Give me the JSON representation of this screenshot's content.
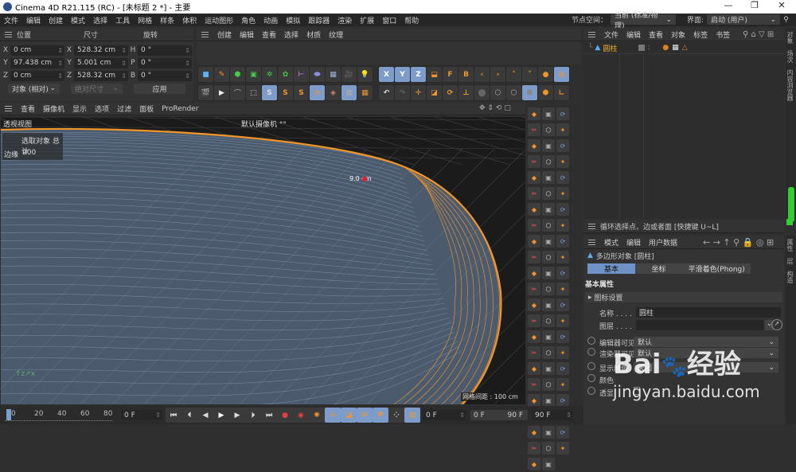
{
  "window": {
    "title": "Cinema 4D R21.115 (RC) - [未标题 2 *] - 主要",
    "min": "—",
    "max": "❐",
    "close": "✕"
  },
  "menu": [
    "文件",
    "编辑",
    "创建",
    "模式",
    "选择",
    "工具",
    "网格",
    "样条",
    "体积",
    "运动图形",
    "角色",
    "动画",
    "模拟",
    "跟踪器",
    "渲染",
    "扩展",
    "窗口",
    "帮助"
  ],
  "node_space": {
    "label": "节点空间：",
    "value": "当前 (标准/物理)"
  },
  "layout": {
    "label": "界面:",
    "value": "启动 (用户)"
  },
  "coords": {
    "headers": [
      "位置",
      "尺寸",
      "旋转"
    ],
    "rows": [
      {
        "axis": "X",
        "pos": "0 cm",
        "saxis": "X",
        "size": "528.32 cm",
        "raxis": "H",
        "rot": "0 °"
      },
      {
        "axis": "Y",
        "pos": "97.438 cm",
        "saxis": "Y",
        "size": "5.001 cm",
        "raxis": "P",
        "rot": "0 °"
      },
      {
        "axis": "Z",
        "pos": "0 cm",
        "saxis": "Z",
        "size": "528.32 cm",
        "raxis": "B",
        "rot": "0 °"
      }
    ],
    "mode": "对象 (相对)",
    "size_mode": "绝对尺寸",
    "apply": "应用"
  },
  "material_menu": [
    "创建",
    "编辑",
    "查看",
    "选择",
    "材质",
    "纹理"
  ],
  "viewport": {
    "menu": [
      "查看",
      "摄像机",
      "显示",
      "选项",
      "过滤",
      "面板",
      "ProRender"
    ],
    "name": "透视视图",
    "camera": "默认摄像机 °°",
    "hud_title": "选取对象 总计",
    "hud_label": "边缘",
    "hud_value": "900",
    "measure": "9.0 cm",
    "grid": "网格间距 : 100 cm"
  },
  "objects": {
    "menu": [
      "文件",
      "编辑",
      "查看",
      "对象",
      "标签",
      "书签"
    ],
    "items": [
      {
        "name": "圆柱"
      }
    ]
  },
  "status": "循环选择点、边或者面 [快捷键 U~L]",
  "attributes": {
    "menu": [
      "模式",
      "编辑",
      "用户数据"
    ],
    "object_title": "多边形对象 [圆柱]",
    "tabs": [
      "基本",
      "坐标",
      "平滑着色(Phong)"
    ],
    "section": "基本属性",
    "group": "图标设置",
    "name_label": "名称 . . . .",
    "name_value": "圆柱",
    "layer_label": "图层 . . . .",
    "editor_vis_label": "编辑器可见",
    "editor_vis": "默认",
    "render_vis_label": "渲染器可见",
    "render_vis": "默认",
    "display_color_label": "显示颜色",
    "display_color": "关闭",
    "color_label": "颜色",
    "xray_label": "透显"
  },
  "side_tabs": [
    "对象",
    "场次",
    "内容浏览器"
  ],
  "attr_side_tabs": [
    "属性",
    "层",
    "构造"
  ],
  "timeline": {
    "ticks": [
      "0",
      "20",
      "40",
      "60",
      "80"
    ],
    "current": "0 F",
    "start": "0 F",
    "range_start": "0 F",
    "range_end": "90 F",
    "end": "90 F"
  },
  "watermark": {
    "logo": "Bai du 经验",
    "url": "jingyan.baidu.com"
  },
  "colors": {
    "accent": "#6f93c6",
    "orange": "#f0962a",
    "bg": "#2f2f2f"
  }
}
